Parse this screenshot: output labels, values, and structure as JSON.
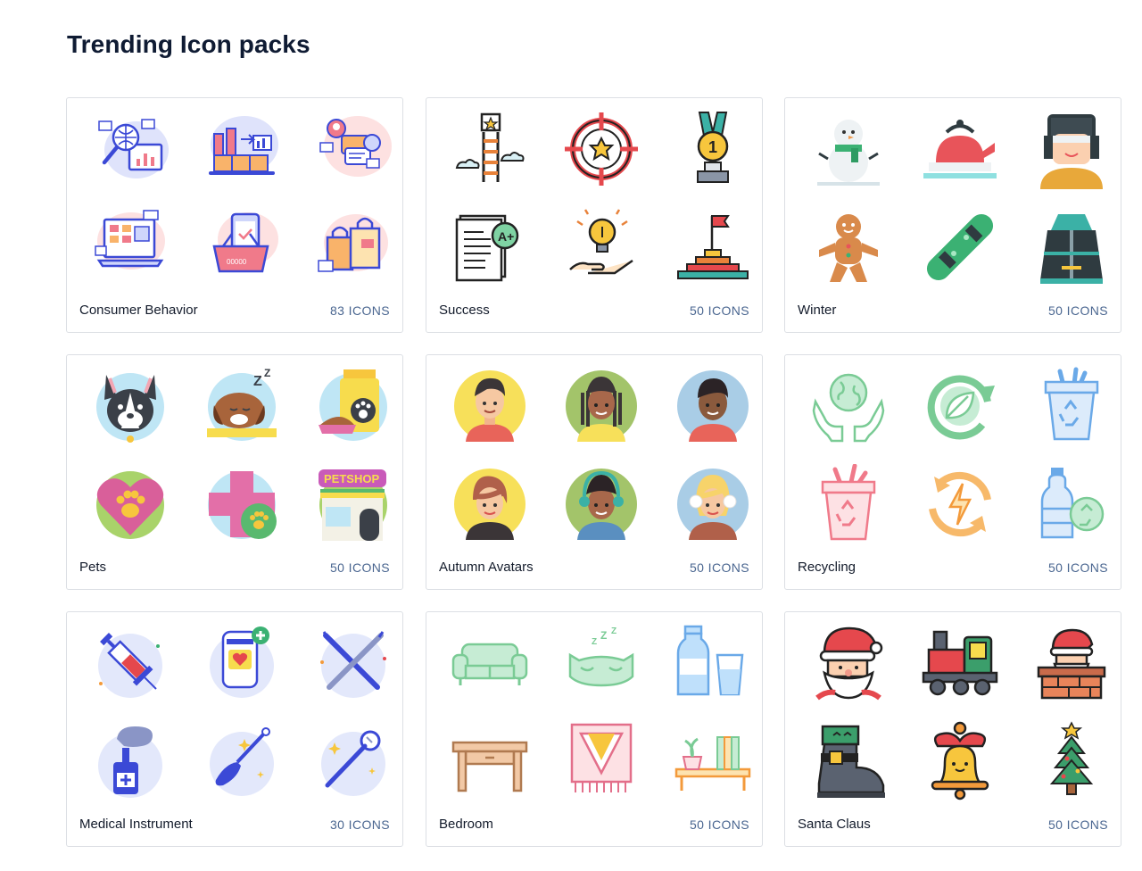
{
  "heading": "Trending Icon packs",
  "packs": [
    {
      "name": "Consumer Behavior",
      "count": "83 ICONS",
      "icons": [
        "magnifier-globe-icon",
        "factory-icon",
        "chat-people-icon",
        "laptop-shop-icon",
        "phone-basket-icon",
        "shopping-bags-icon"
      ]
    },
    {
      "name": "Success",
      "count": "50 ICONS",
      "icons": [
        "ladder-star-icon",
        "target-star-icon",
        "medal-icon",
        "document-grade-icon",
        "hand-bulb-icon",
        "podium-flag-icon"
      ]
    },
    {
      "name": "Winter",
      "count": "50 ICONS",
      "icons": [
        "snowman-icon",
        "kettle-icon",
        "person-hat-icon",
        "gingerbread-icon",
        "snowboard-icon",
        "winter-jacket-icon"
      ]
    },
    {
      "name": "Pets",
      "count": "50 ICONS",
      "icons": [
        "dog-icon",
        "sleeping-dog-icon",
        "pet-food-icon",
        "heart-paw-icon",
        "vet-cross-icon",
        "petshop-icon"
      ]
    },
    {
      "name": "Autumn Avatars",
      "count": "50 ICONS",
      "icons": [
        "man-avatar-icon",
        "woman-braids-avatar-icon",
        "man-dark-avatar-icon",
        "woman-avatar-icon",
        "person-earmuffs-avatar-icon",
        "blonde-earmuffs-avatar-icon"
      ]
    },
    {
      "name": "Recycling",
      "count": "50 ICONS",
      "icons": [
        "hands-earth-icon",
        "leaf-cycle-icon",
        "recycle-bin-blue-icon",
        "recycle-bin-pink-icon",
        "energy-cycle-icon",
        "bottle-recycle-icon"
      ]
    },
    {
      "name": "Medical Instrument",
      "count": "30 ICONS",
      "icons": [
        "syringe-icon",
        "medical-device-icon",
        "dental-tools-icon",
        "nasal-spray-icon",
        "ear-cleaner-icon",
        "dental-mirror-icon"
      ]
    },
    {
      "name": "Bedroom",
      "count": "50 ICONS",
      "icons": [
        "sofa-icon",
        "sleep-mask-icon",
        "milk-glass-icon",
        "desk-icon",
        "rug-icon",
        "bookshelf-icon"
      ]
    },
    {
      "name": "Santa Claus",
      "count": "50 ICONS",
      "icons": [
        "santa-icon",
        "train-icon",
        "santa-chimney-icon",
        "elf-boot-icon",
        "bell-icon",
        "christmas-tree-icon"
      ]
    }
  ]
}
